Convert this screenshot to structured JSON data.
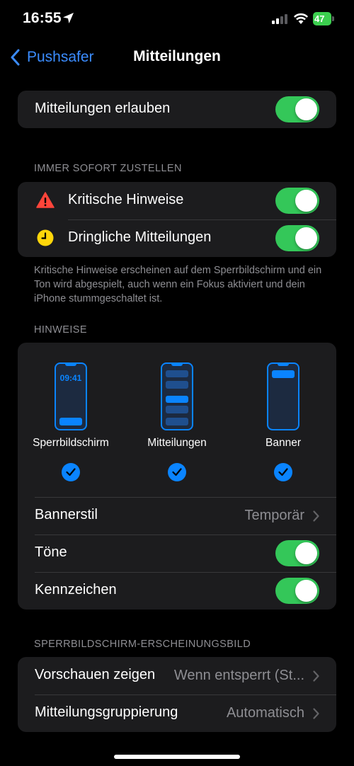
{
  "status_bar": {
    "time": "16:55",
    "battery_level": "47"
  },
  "nav": {
    "back_label": "Pushsafer",
    "title": "Mitteilungen"
  },
  "allow": {
    "label": "Mitteilungen erlauben",
    "enabled": true
  },
  "immediate": {
    "header": "IMMER SOFORT ZUSTELLEN",
    "items": [
      {
        "label": "Kritische Hinweise",
        "icon": "warning-icon",
        "enabled": true
      },
      {
        "label": "Dringliche Mitteilungen",
        "icon": "clock-icon",
        "enabled": true
      }
    ],
    "footnote": "Kritische Hinweise erscheinen auf dem Sperrbildschirm und ein Ton wird abgespielt, auch wenn ein Fokus aktiviert und dein iPhone stummgeschaltet ist."
  },
  "alerts": {
    "header": "HINWEISE",
    "styles": [
      {
        "label": "Sperrbildschirm",
        "preview_time": "09:41",
        "checked": true
      },
      {
        "label": "Mitteilungen",
        "checked": true
      },
      {
        "label": "Banner",
        "checked": true
      }
    ],
    "banner_style": {
      "label": "Bannerstil",
      "value": "Temporär"
    },
    "sounds": {
      "label": "Töne",
      "enabled": true
    },
    "badges": {
      "label": "Kennzeichen",
      "enabled": true
    }
  },
  "lock_screen": {
    "header": "SPERRBILDSCHIRM-ERSCHEINUNGSBILD",
    "show_previews": {
      "label": "Vorschauen zeigen",
      "value": "Wenn entsperrt (St..."
    },
    "grouping": {
      "label": "Mitteilungsgruppierung",
      "value": "Automatisch"
    }
  },
  "colors": {
    "accent": "#0a84ff",
    "toggle_on": "#34c759",
    "warning": "#ff453a",
    "clock": "#ffd60a"
  }
}
